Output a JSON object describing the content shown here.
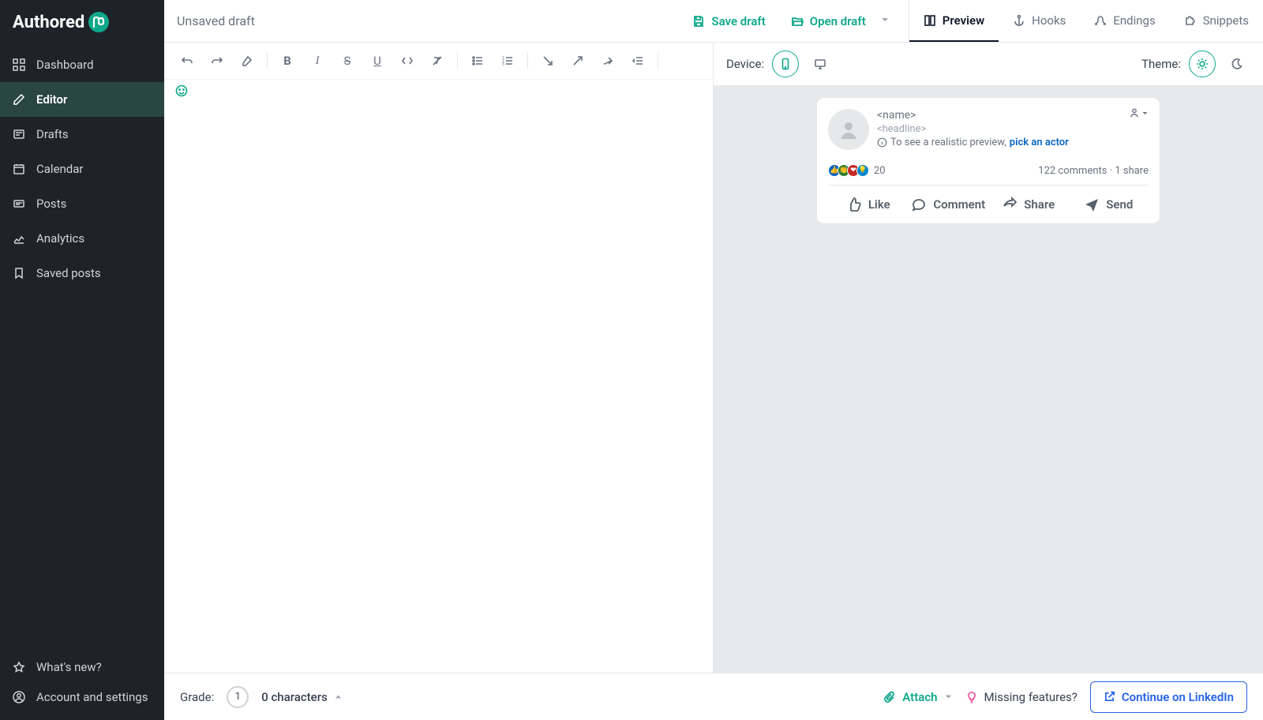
{
  "logo": {
    "text": "Authored"
  },
  "sidebar": {
    "items": [
      {
        "label": "Dashboard"
      },
      {
        "label": "Editor"
      },
      {
        "label": "Drafts"
      },
      {
        "label": "Calendar"
      },
      {
        "label": "Posts"
      },
      {
        "label": "Analytics"
      },
      {
        "label": "Saved posts"
      }
    ],
    "bottom": [
      {
        "label": "What's new?"
      },
      {
        "label": "Account and settings"
      }
    ]
  },
  "header": {
    "draft_title": "Unsaved draft",
    "save_draft": "Save draft",
    "open_draft": "Open draft",
    "tabs": [
      {
        "label": "Preview"
      },
      {
        "label": "Hooks"
      },
      {
        "label": "Endings"
      },
      {
        "label": "Snippets"
      }
    ]
  },
  "preview": {
    "device_label": "Device:",
    "theme_label": "Theme:",
    "post": {
      "name": "<name>",
      "headline": "<headline>",
      "hint_prefix": "To see a realistic preview, ",
      "hint_link": "pick an actor",
      "reactions_count": "20",
      "engagement": "122 comments · 1 share",
      "actions": {
        "like": "Like",
        "comment": "Comment",
        "share": "Share",
        "send": "Send"
      }
    }
  },
  "footer": {
    "grade_label": "Grade:",
    "grade_value": "1",
    "char_count": "0 characters",
    "attach": "Attach",
    "missing": "Missing features?",
    "continue": "Continue on LinkedIn"
  },
  "colors": {
    "teal": "#0ea88b",
    "blue_link": "#0a66c2",
    "blue_outline": "#2563eb"
  }
}
